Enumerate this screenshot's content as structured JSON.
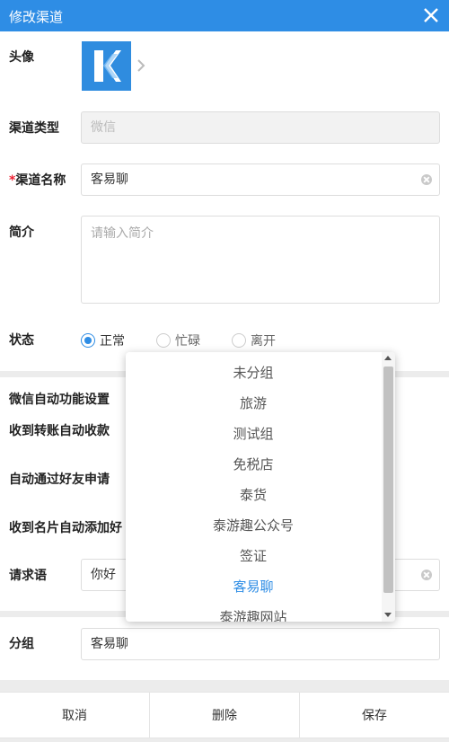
{
  "window": {
    "title": "修改渠道"
  },
  "form": {
    "avatar_label": "头像",
    "channel_type_label": "渠道类型",
    "channel_type_value": "微信",
    "channel_name_required_mark": "*",
    "channel_name_label": "渠道名称",
    "channel_name_value": "客易聊",
    "intro_label": "简介",
    "intro_placeholder": "请输入简介",
    "status_label": "状态",
    "status_options": [
      {
        "label": "正常",
        "checked": true
      },
      {
        "label": "忙碌",
        "checked": false
      },
      {
        "label": "离开",
        "checked": false
      }
    ]
  },
  "wechat_auto": {
    "section_title": "微信自动功能设置",
    "auto_receive_transfer_label": "收到转账自动收款",
    "auto_accept_friend_label": "自动通过好友申请",
    "auto_add_card_label": "收到名片自动添加好",
    "greeting_label": "请求语",
    "greeting_value": "你好"
  },
  "group": {
    "label": "分组",
    "value": "客易聊"
  },
  "dropdown": {
    "options": [
      "未分组",
      "旅游",
      "测试组",
      "免税店",
      "泰货",
      "泰游趣公众号",
      "签证",
      "客易聊",
      "泰游趣网站"
    ],
    "selected": "客易聊"
  },
  "footer": {
    "cancel": "取消",
    "delete": "删除",
    "save": "保存"
  },
  "colors": {
    "accent": "#2e8de5",
    "required": "#e23"
  }
}
